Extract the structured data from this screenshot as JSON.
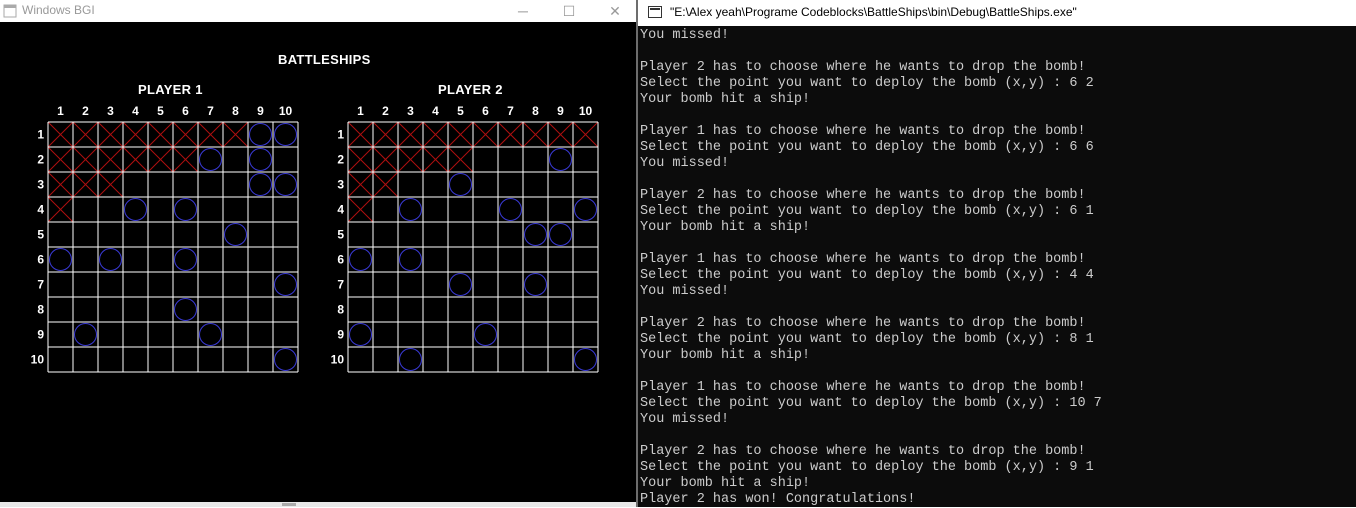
{
  "bgi_window": {
    "title": "Windows BGI",
    "minimize_glyph": "─",
    "maximize_glyph": "☐",
    "close_glyph": "✕",
    "game_title": "BATTLESHIPS",
    "grid_size": 10,
    "colors": {
      "background": "#000000",
      "grid": "#ffffff",
      "hit_cross": "#b01010",
      "miss_circle": "#3a3ad8",
      "text": "#ffffff"
    },
    "boards": [
      {
        "player_label": "PLAYER 1",
        "col_labels": [
          "1",
          "2",
          "3",
          "4",
          "5",
          "6",
          "7",
          "8",
          "9",
          "10"
        ],
        "row_labels": [
          "1",
          "2",
          "3",
          "4",
          "5",
          "6",
          "7",
          "8",
          "9",
          "10"
        ],
        "hits": [
          [
            1,
            1
          ],
          [
            2,
            1
          ],
          [
            3,
            1
          ],
          [
            4,
            1
          ],
          [
            5,
            1
          ],
          [
            6,
            1
          ],
          [
            7,
            1
          ],
          [
            8,
            1
          ],
          [
            1,
            2
          ],
          [
            2,
            2
          ],
          [
            3,
            2
          ],
          [
            4,
            2
          ],
          [
            5,
            2
          ],
          [
            6,
            2
          ],
          [
            1,
            3
          ],
          [
            2,
            3
          ],
          [
            3,
            3
          ],
          [
            1,
            4
          ]
        ],
        "misses": [
          [
            9,
            1
          ],
          [
            10,
            1
          ],
          [
            7,
            2
          ],
          [
            9,
            2
          ],
          [
            9,
            3
          ],
          [
            10,
            3
          ],
          [
            4,
            4
          ],
          [
            6,
            4
          ],
          [
            8,
            5
          ],
          [
            1,
            6
          ],
          [
            3,
            6
          ],
          [
            6,
            6
          ],
          [
            10,
            7
          ],
          [
            6,
            8
          ],
          [
            2,
            9
          ],
          [
            7,
            9
          ],
          [
            10,
            10
          ]
        ]
      },
      {
        "player_label": "PLAYER 2",
        "col_labels": [
          "1",
          "2",
          "3",
          "4",
          "5",
          "6",
          "7",
          "8",
          "9",
          "10"
        ],
        "row_labels": [
          "1",
          "2",
          "3",
          "4",
          "5",
          "6",
          "7",
          "8",
          "9",
          "10"
        ],
        "hits": [
          [
            1,
            1
          ],
          [
            2,
            1
          ],
          [
            3,
            1
          ],
          [
            4,
            1
          ],
          [
            5,
            1
          ],
          [
            6,
            1
          ],
          [
            7,
            1
          ],
          [
            8,
            1
          ],
          [
            9,
            1
          ],
          [
            10,
            1
          ],
          [
            1,
            2
          ],
          [
            2,
            2
          ],
          [
            3,
            2
          ],
          [
            4,
            2
          ],
          [
            5,
            2
          ],
          [
            1,
            3
          ],
          [
            2,
            3
          ],
          [
            1,
            4
          ]
        ],
        "misses": [
          [
            9,
            2
          ],
          [
            5,
            3
          ],
          [
            3,
            4
          ],
          [
            7,
            4
          ],
          [
            10,
            4
          ],
          [
            8,
            5
          ],
          [
            9,
            5
          ],
          [
            1,
            6
          ],
          [
            3,
            6
          ],
          [
            5,
            7
          ],
          [
            8,
            7
          ],
          [
            1,
            9
          ],
          [
            6,
            9
          ],
          [
            3,
            10
          ],
          [
            10,
            10
          ]
        ]
      }
    ]
  },
  "console_window": {
    "title": "\"E:\\Alex yeah\\Programe Codeblocks\\BattleShips\\bin\\Debug\\BattleShips.exe\"",
    "lines": [
      "You missed!",
      "",
      "Player 2 has to choose where he wants to drop the bomb!",
      "Select the point you want to deploy the bomb (x,y) : 6 2",
      "Your bomb hit a ship!",
      "",
      "Player 1 has to choose where he wants to drop the bomb!",
      "Select the point you want to deploy the bomb (x,y) : 6 6",
      "You missed!",
      "",
      "Player 2 has to choose where he wants to drop the bomb!",
      "Select the point you want to deploy the bomb (x,y) : 6 1",
      "Your bomb hit a ship!",
      "",
      "Player 1 has to choose where he wants to drop the bomb!",
      "Select the point you want to deploy the bomb (x,y) : 4 4",
      "You missed!",
      "",
      "Player 2 has to choose where he wants to drop the bomb!",
      "Select the point you want to deploy the bomb (x,y) : 8 1",
      "Your bomb hit a ship!",
      "",
      "Player 1 has to choose where he wants to drop the bomb!",
      "Select the point you want to deploy the bomb (x,y) : 10 7",
      "You missed!",
      "",
      "Player 2 has to choose where he wants to drop the bomb!",
      "Select the point you want to deploy the bomb (x,y) : 9 1",
      "Your bomb hit a ship!",
      "Player 2 has won! Congratulations!"
    ]
  }
}
